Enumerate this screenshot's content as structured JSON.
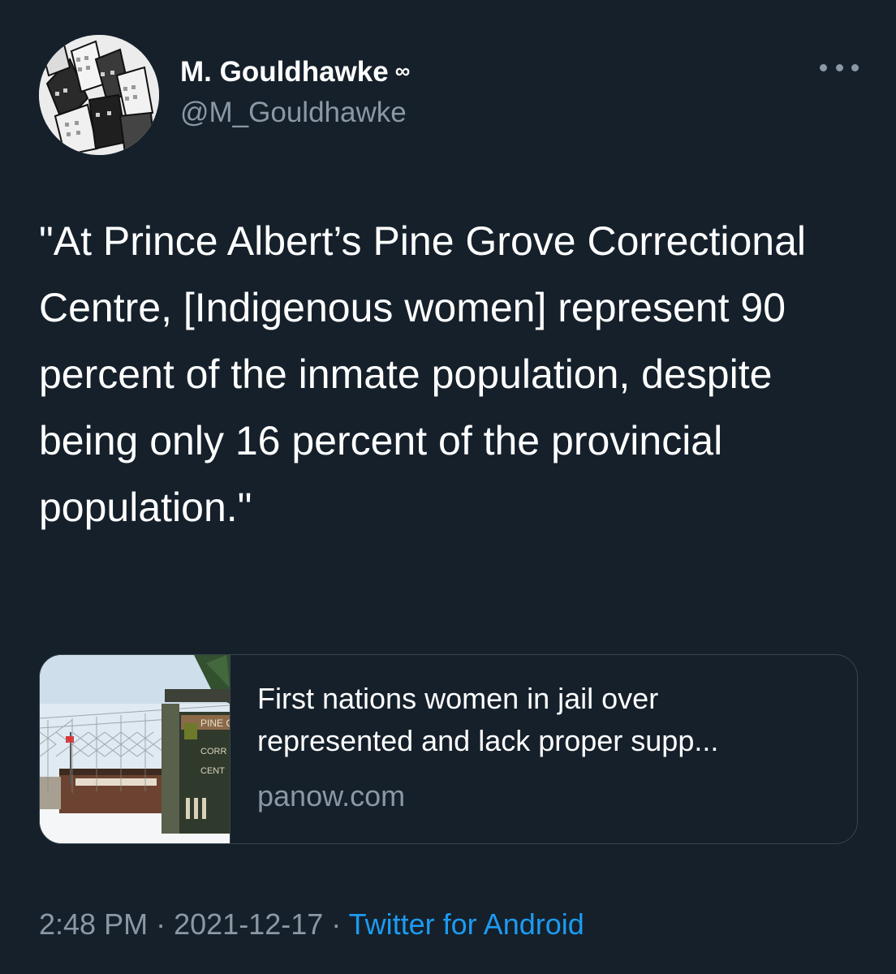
{
  "author": {
    "display_name": "M. Gouldhawke",
    "badge": "∞",
    "handle": "@M_Gouldhawke"
  },
  "tweet": {
    "text": "\"At Prince Albert’s Pine Grove Correctional Centre, [Indigenous women] represent 90 percent of the inmate population, despite being only 16 percent of the provincial population.\""
  },
  "link_card": {
    "title_line1": "First nations women in jail over",
    "title_line2": "represented and lack proper supp...",
    "domain": "panow.com",
    "image_sign_text": [
      "PINE G",
      "CORR",
      "CENT"
    ]
  },
  "meta": {
    "time": "2:48 PM",
    "separator": "·",
    "date": "2021-12-17",
    "source": "Twitter for Android"
  },
  "colors": {
    "background": "#15202b",
    "primary_text": "#ffffff",
    "secondary_text": "#8b98a5",
    "link": "#1d9bf0",
    "border": "#38444d"
  },
  "icons": {
    "more": "more-horizontal-icon"
  }
}
